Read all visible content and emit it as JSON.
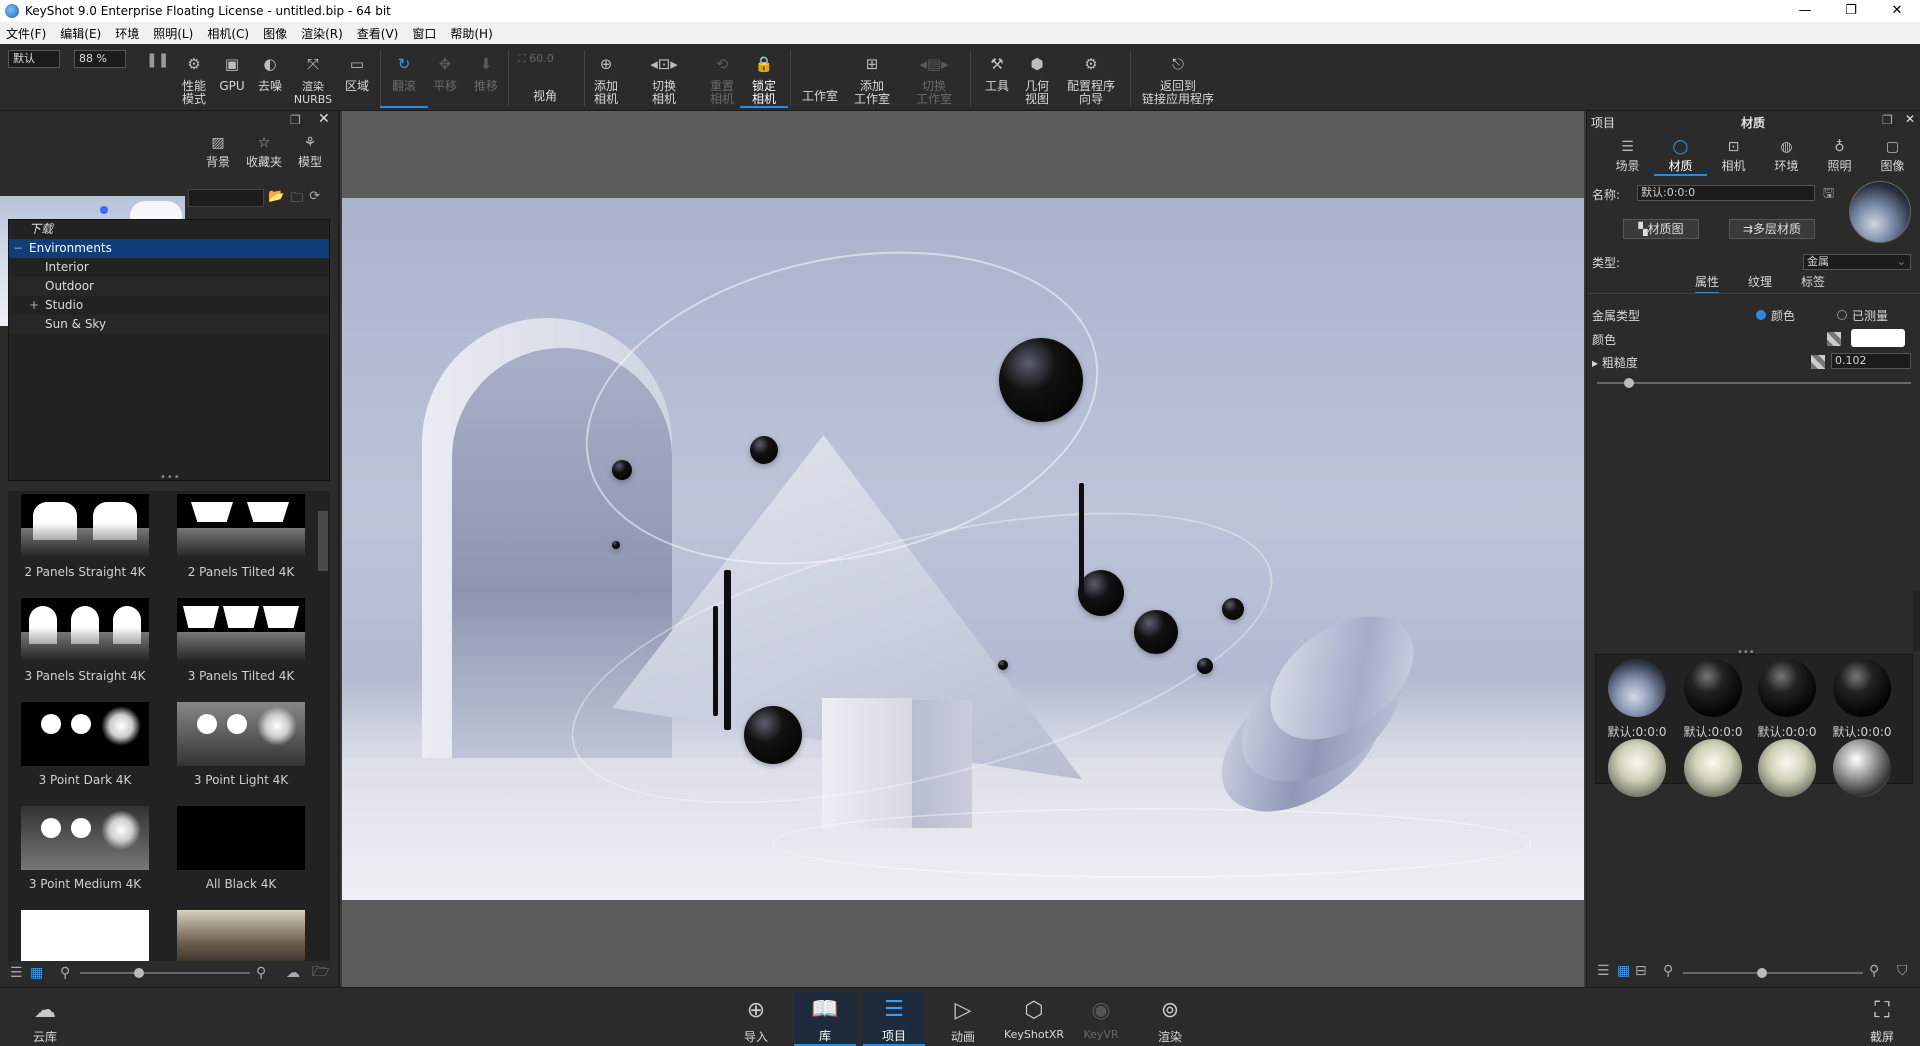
{
  "window": {
    "title": "KeyShot 9.0 Enterprise Floating License  - untitled.bip  - 64 bit",
    "controls": [
      "—",
      "❐",
      "✕"
    ]
  },
  "menu": [
    "文件(F)",
    "编辑(E)",
    "环境",
    "照明(L)",
    "相机(C)",
    "图像",
    "渲染(R)",
    "查看(V)",
    "窗口",
    "帮助(H)"
  ],
  "toolbar": {
    "preset_select": "默认",
    "zoom_value": "88 %",
    "fov_value": "60.0",
    "buttons": {
      "performance": "性能\n模式",
      "gpu": "GPU",
      "denoise": "去噪",
      "render_nurbs": "渲染\nNURBS",
      "region": "区域",
      "tumble": "翻滚",
      "pan": "平移",
      "dolly": "推移",
      "perspective": "视角",
      "add_camera": "添加\n相机",
      "switch_camera": "切换\n相机",
      "reset_camera": "重置\n相机",
      "lock_camera": "锁定\n相机",
      "studio": "工作室",
      "add_studio": "添加\n工作室",
      "switch_studio": "切换\n工作室",
      "tools": "工具",
      "geometry_view": "几何\n视图",
      "config_wizard": "配置程序\n向导",
      "return_app": "返回到\n链接应用程序"
    }
  },
  "library": {
    "tabs": [
      "背景",
      "收藏夹",
      "模型"
    ],
    "tree": [
      {
        "label": "下载",
        "level": 0,
        "expander": ""
      },
      {
        "label": "Environments",
        "level": 0,
        "expander": "−",
        "selected": true
      },
      {
        "label": "Interior",
        "level": 1,
        "expander": ""
      },
      {
        "label": "Outdoor",
        "level": 1,
        "expander": ""
      },
      {
        "label": "Studio",
        "level": 1,
        "expander": "+"
      },
      {
        "label": "Sun & Sky",
        "level": 1,
        "expander": ""
      }
    ],
    "items": [
      "2 Panels Straight 4K",
      "2 Panels Tilted 4K",
      "3 Panels Straight 4K",
      "3 Panels Tilted 4K",
      "3 Point Dark 4K",
      "3 Point Light 4K",
      "3 Point Medium 4K",
      "All Black 4K"
    ]
  },
  "project": {
    "header_left": "项目",
    "header_center": "材质",
    "tabs": [
      "场景",
      "材质",
      "相机",
      "环境",
      "照明",
      "图像"
    ],
    "active_tab": "材质",
    "name_label": "名称:",
    "name_value": "默认:0:0:0",
    "material_graph_btn": "材质图",
    "multilayer_btn": "多层材质",
    "type_label": "类型:",
    "type_value": "金属",
    "subtabs": [
      "属性",
      "纹理",
      "标签"
    ],
    "metal_type_label": "金属类型",
    "radio_color": "颜色",
    "radio_measured": "已测量",
    "color_label": "颜色",
    "roughness_label": "粗糙度",
    "roughness_value": "0.102",
    "roughness_fraction": 0.102,
    "swatches": [
      {
        "label": "默认:0:0:0",
        "style": "hdr"
      },
      {
        "label": "默认:0:0:0",
        "style": "dark"
      },
      {
        "label": "默认:0:0:0",
        "style": "dark"
      },
      {
        "label": "默认:0:0:0",
        "style": "dark"
      },
      {
        "label": "",
        "style": "light"
      },
      {
        "label": "",
        "style": "light"
      },
      {
        "label": "",
        "style": "light"
      },
      {
        "label": "",
        "style": "chrome"
      }
    ]
  },
  "bottombar": {
    "cloud": "云库",
    "import": "导入",
    "library": "库",
    "project": "项目",
    "animation": "动画",
    "keyshotxr": "KeyShotXR",
    "keyvr": "KeyVR",
    "render": "渲染",
    "screenshot": "截屏"
  },
  "colors": {
    "accent": "#2a8adb",
    "selection": "#0f3e7a",
    "panel_bg": "#2b2b2b"
  }
}
